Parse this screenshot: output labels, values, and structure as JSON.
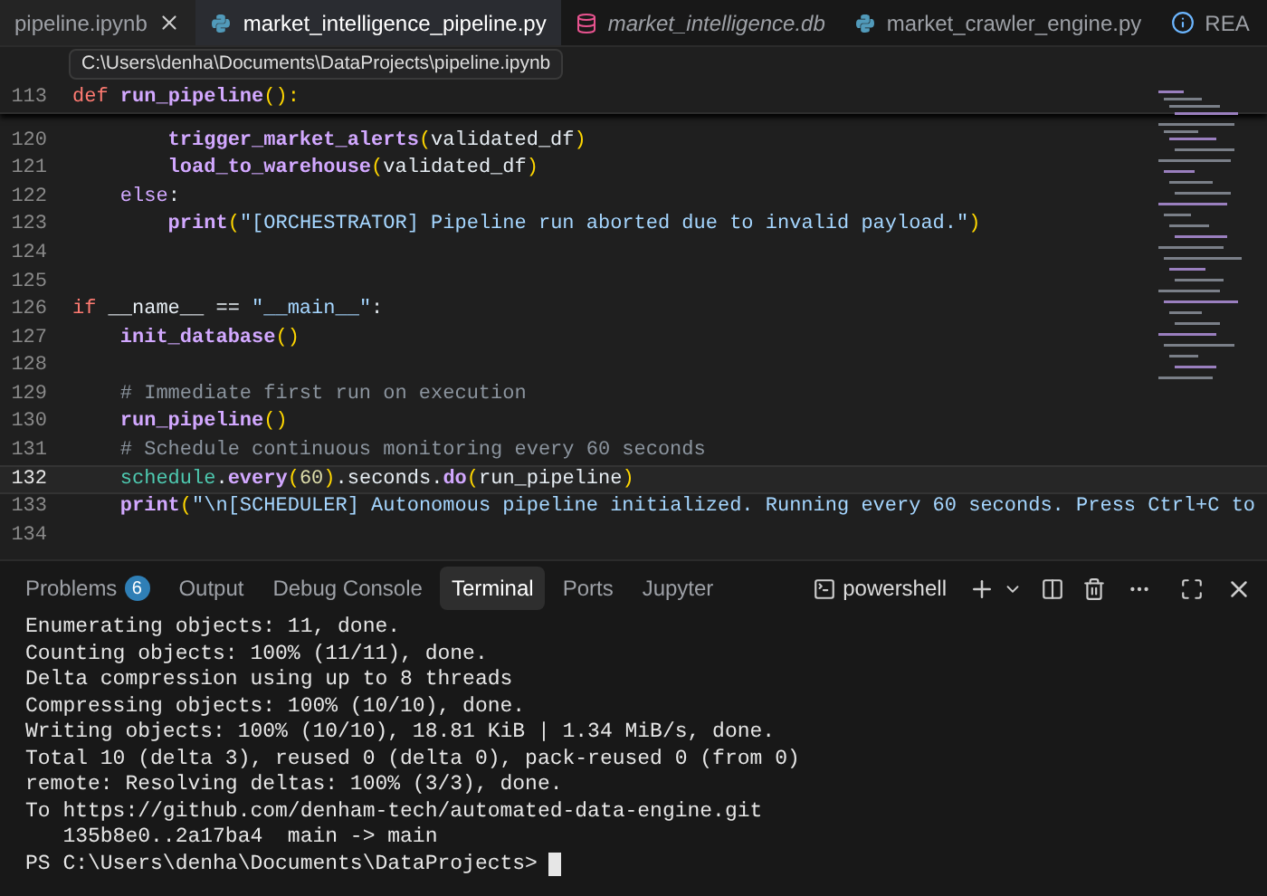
{
  "editor_tabs": [
    {
      "label": "pipeline.ipynb",
      "selected": false,
      "preview": false,
      "hovered": true
    },
    {
      "label": "market_intelligence_pipeline.py",
      "kind": "python",
      "selected": true,
      "preview": false,
      "hovered": false
    },
    {
      "label": "market_intelligence.db",
      "kind": "database",
      "selected": false,
      "preview": true,
      "hovered": false
    },
    {
      "label": "market_crawler_engine.py",
      "kind": "python",
      "selected": false,
      "preview": false,
      "hovered": false
    },
    {
      "label": "REA",
      "kind": "info",
      "selected": false,
      "preview": false,
      "hovered": false
    }
  ],
  "tooltip": "C:\\Users\\denha\\Documents\\DataProjects\\pipeline.ipynb",
  "code_lines": [
    {
      "number": "113",
      "sticky": true,
      "current": false,
      "tokens": [
        {
          "text": "def",
          "kind": "keyword"
        },
        {
          "text": " run_pipeline",
          "kind": "function"
        },
        {
          "text": "():",
          "kind": "paren"
        }
      ]
    },
    {
      "number": "120",
      "sticky": false,
      "current": false,
      "tokens": [
        {
          "text": "        trigger_market_alerts",
          "kind": "function"
        },
        {
          "text": "(",
          "kind": "paren"
        },
        {
          "text": "validated_df",
          "kind": "plain"
        },
        {
          "text": ")",
          "kind": "paren"
        }
      ]
    },
    {
      "number": "121",
      "sticky": false,
      "current": false,
      "tokens": [
        {
          "text": "        load_to_warehouse",
          "kind": "function"
        },
        {
          "text": "(",
          "kind": "paren"
        },
        {
          "text": "validated_df",
          "kind": "plain"
        },
        {
          "text": ")",
          "kind": "paren"
        }
      ]
    },
    {
      "number": "122",
      "sticky": false,
      "current": false,
      "tokens": [
        {
          "text": "    else",
          "kind": "control"
        },
        {
          "text": ":",
          "kind": "plain"
        }
      ]
    },
    {
      "number": "123",
      "sticky": false,
      "current": false,
      "tokens": [
        {
          "text": "        print",
          "kind": "function"
        },
        {
          "text": "(",
          "kind": "paren"
        },
        {
          "text": "\"[ORCHESTRATOR] Pipeline run aborted due to invalid payload.\"",
          "kind": "string"
        },
        {
          "text": ")",
          "kind": "paren"
        }
      ]
    },
    {
      "number": "124",
      "sticky": false,
      "current": false
    },
    {
      "number": "125",
      "sticky": false,
      "current": false
    },
    {
      "number": "126",
      "sticky": false,
      "current": false,
      "tokens": [
        {
          "text": "if",
          "kind": "keyword"
        },
        {
          "text": " __name__ == ",
          "kind": "plain"
        },
        {
          "text": "\"__main__\"",
          "kind": "string"
        },
        {
          "text": ":",
          "kind": "plain"
        }
      ]
    },
    {
      "number": "127",
      "sticky": false,
      "current": false,
      "tokens": [
        {
          "text": "    init_database",
          "kind": "function"
        },
        {
          "text": "()",
          "kind": "paren"
        }
      ]
    },
    {
      "number": "128",
      "sticky": false,
      "current": false
    },
    {
      "number": "129",
      "sticky": false,
      "current": false,
      "tokens": [
        {
          "text": "    # Immediate first run on execution",
          "kind": "comment"
        }
      ]
    },
    {
      "number": "130",
      "sticky": false,
      "current": false,
      "tokens": [
        {
          "text": "    run_pipeline",
          "kind": "function"
        },
        {
          "text": "()",
          "kind": "paren"
        }
      ]
    },
    {
      "number": "131",
      "sticky": false,
      "current": false,
      "tokens": [
        {
          "text": "    # Schedule continuous monitoring every 60 seconds",
          "kind": "comment"
        }
      ]
    },
    {
      "number": "132",
      "sticky": false,
      "current": true,
      "tokens": [
        {
          "text": "    schedule",
          "kind": "module"
        },
        {
          "text": ".",
          "kind": "plain"
        },
        {
          "text": "every",
          "kind": "function"
        },
        {
          "text": "(",
          "kind": "paren"
        },
        {
          "text": "60",
          "kind": "number"
        },
        {
          "text": ")",
          "kind": "paren"
        },
        {
          "text": ".seconds.",
          "kind": "plain"
        },
        {
          "text": "do",
          "kind": "function"
        },
        {
          "text": "(",
          "kind": "paren"
        },
        {
          "text": "run_pipeline",
          "kind": "plain"
        },
        {
          "text": ")",
          "kind": "paren"
        }
      ]
    },
    {
      "number": "133",
      "sticky": false,
      "current": false,
      "tokens": [
        {
          "text": "    print",
          "kind": "function"
        },
        {
          "text": "(",
          "kind": "paren"
        },
        {
          "text": "\"\\n[SCHEDULER] Autonomous pipeline initialized. Running every 60 seconds. Press Ctrl+C to",
          "kind": "string"
        }
      ]
    },
    {
      "number": "134",
      "sticky": false,
      "current": false
    }
  ],
  "panel_tabs": [
    {
      "label": "Problems",
      "badge": "6",
      "selected": false
    },
    {
      "label": "Output",
      "selected": false
    },
    {
      "label": "Debug Console",
      "selected": false
    },
    {
      "label": "Terminal",
      "selected": true
    },
    {
      "label": "Ports",
      "selected": false
    },
    {
      "label": "Jupyter",
      "selected": false
    }
  ],
  "terminal_profile": "powershell",
  "terminal_lines": [
    "Enumerating objects: 11, done.",
    "Counting objects: 100% (11/11), done.",
    "Delta compression using up to 8 threads",
    "Compressing objects: 100% (10/10), done.",
    "Writing objects: 100% (10/10), 18.81 KiB | 1.34 MiB/s, done.",
    "Total 10 (delta 3), reused 0 (delta 0), pack-reused 0 (from 0)",
    "remote: Resolving deltas: 100% (3/3), done.",
    "To https://github.com/denham-tech/automated-data-engine.git",
    "   135b8e0..2a17ba4  main -> main"
  ],
  "prompt": "PS C:\\Users\\denha\\Documents\\DataProjects>"
}
